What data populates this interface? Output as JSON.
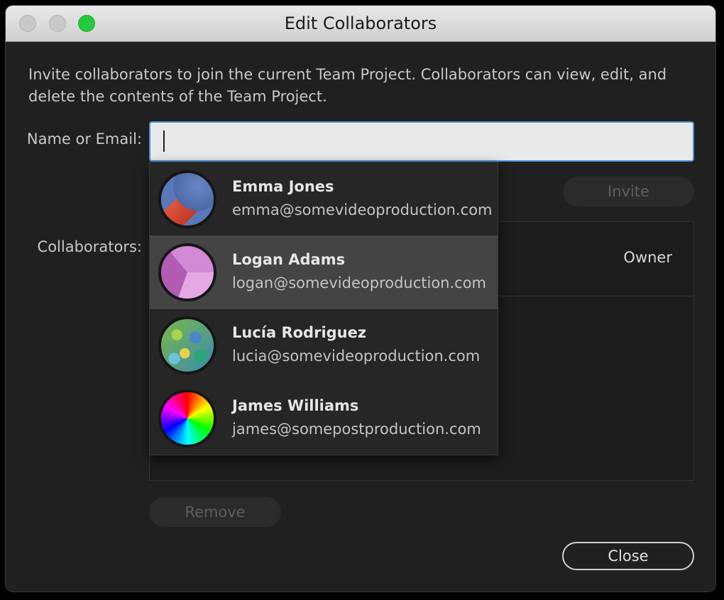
{
  "window": {
    "title": "Edit Collaborators"
  },
  "description": "Invite collaborators to join the current Team Project. Collaborators can view, edit, and delete the contents of the Team Project.",
  "form": {
    "name_label": "Name or Email:",
    "name_value": "",
    "invite_label": "Invite",
    "collaborators_label": "Collaborators:"
  },
  "collaborators": {
    "rows": [
      {
        "role": "Owner"
      }
    ]
  },
  "suggestions": [
    {
      "name": "Emma Jones",
      "email": "emma@somevideoproduction.com",
      "avatar": "red-rock-avatar"
    },
    {
      "name": "Logan Adams",
      "email": "logan@somevideoproduction.com",
      "avatar": "purple-cube-avatar"
    },
    {
      "name": "Lucía Rodriguez",
      "email": "lucia@somevideoproduction.com",
      "avatar": "mosaic-avatar"
    },
    {
      "name": "James Williams",
      "email": "james@somepostproduction.com",
      "avatar": "color-wheel-avatar"
    }
  ],
  "buttons": {
    "remove_label": "Remove",
    "close_label": "Close"
  },
  "colors": {
    "window_bg": "#202020",
    "input_focus": "#4a90d9",
    "highlight_row": "#444444",
    "maximize_green": "#27c93f"
  }
}
